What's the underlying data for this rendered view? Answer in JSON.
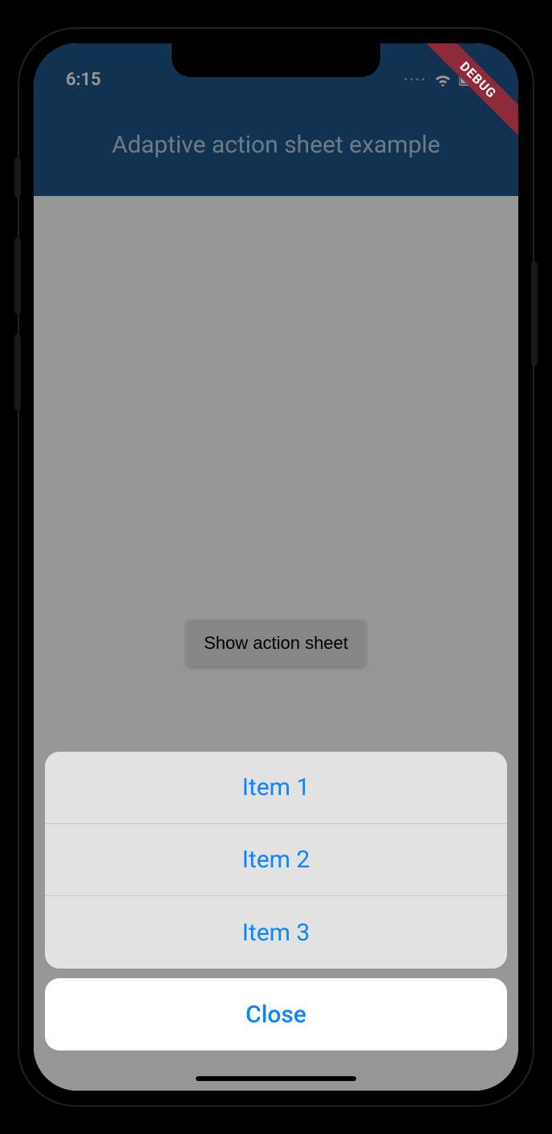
{
  "statusbar": {
    "time": "6:15",
    "dots": "····"
  },
  "appbar": {
    "title": "Adaptive action sheet example"
  },
  "debug_banner": "DEBUG",
  "content": {
    "show_button": "Show action sheet"
  },
  "action_sheet": {
    "items": [
      {
        "label": "Item 1"
      },
      {
        "label": "Item 2"
      },
      {
        "label": "Item 3"
      }
    ],
    "close_label": "Close"
  }
}
